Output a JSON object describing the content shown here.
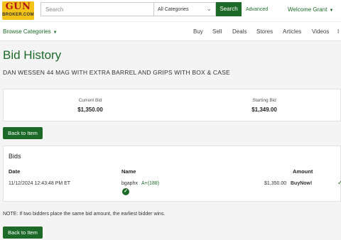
{
  "header": {
    "logo_top": "GUN",
    "logo_bottom": "BROKER.COM",
    "search_placeholder": "Search",
    "category_selected": "All Categories",
    "search_button": "Search",
    "advanced_link": "Advanced",
    "welcome": "Welcome Grant"
  },
  "nav": {
    "browse": "Browse Categories",
    "links": [
      "Buy",
      "Sell",
      "Deals",
      "Stores",
      "Articles",
      "Videos",
      "I"
    ]
  },
  "page": {
    "title": "Bid History",
    "item_title": "DAN WESSEN 44 MAG WITH EXTRA BARREL AND GRIPS WITH BOX & CASE"
  },
  "summary": {
    "current_bid_label": "Current Bid",
    "current_bid_value": "$1,350.00",
    "starting_bid_label": "Starting Bid",
    "starting_bid_value": "$1,349.00"
  },
  "back_button": "Back to Item",
  "bids": {
    "heading": "Bids",
    "columns": {
      "date": "Date",
      "name": "Name",
      "amount": "Amount"
    },
    "rows": [
      {
        "date": "11/12/2024 12:43:48 PM ET",
        "name": "bgaphx",
        "rating": "A+(188)",
        "amount": "$1,350.00",
        "type": "BuyNow!"
      }
    ]
  },
  "note": "NOTE: If two bidders place the same bid amount, the earliest bidder wins.",
  "icons": {
    "chevron": "chevron-down-icon",
    "verified": "check-circle-icon",
    "winner": "check-icon"
  },
  "colors": {
    "brand_green": "#1d6a28",
    "logo_yellow": "#f3c319",
    "logo_red": "#b01818"
  }
}
